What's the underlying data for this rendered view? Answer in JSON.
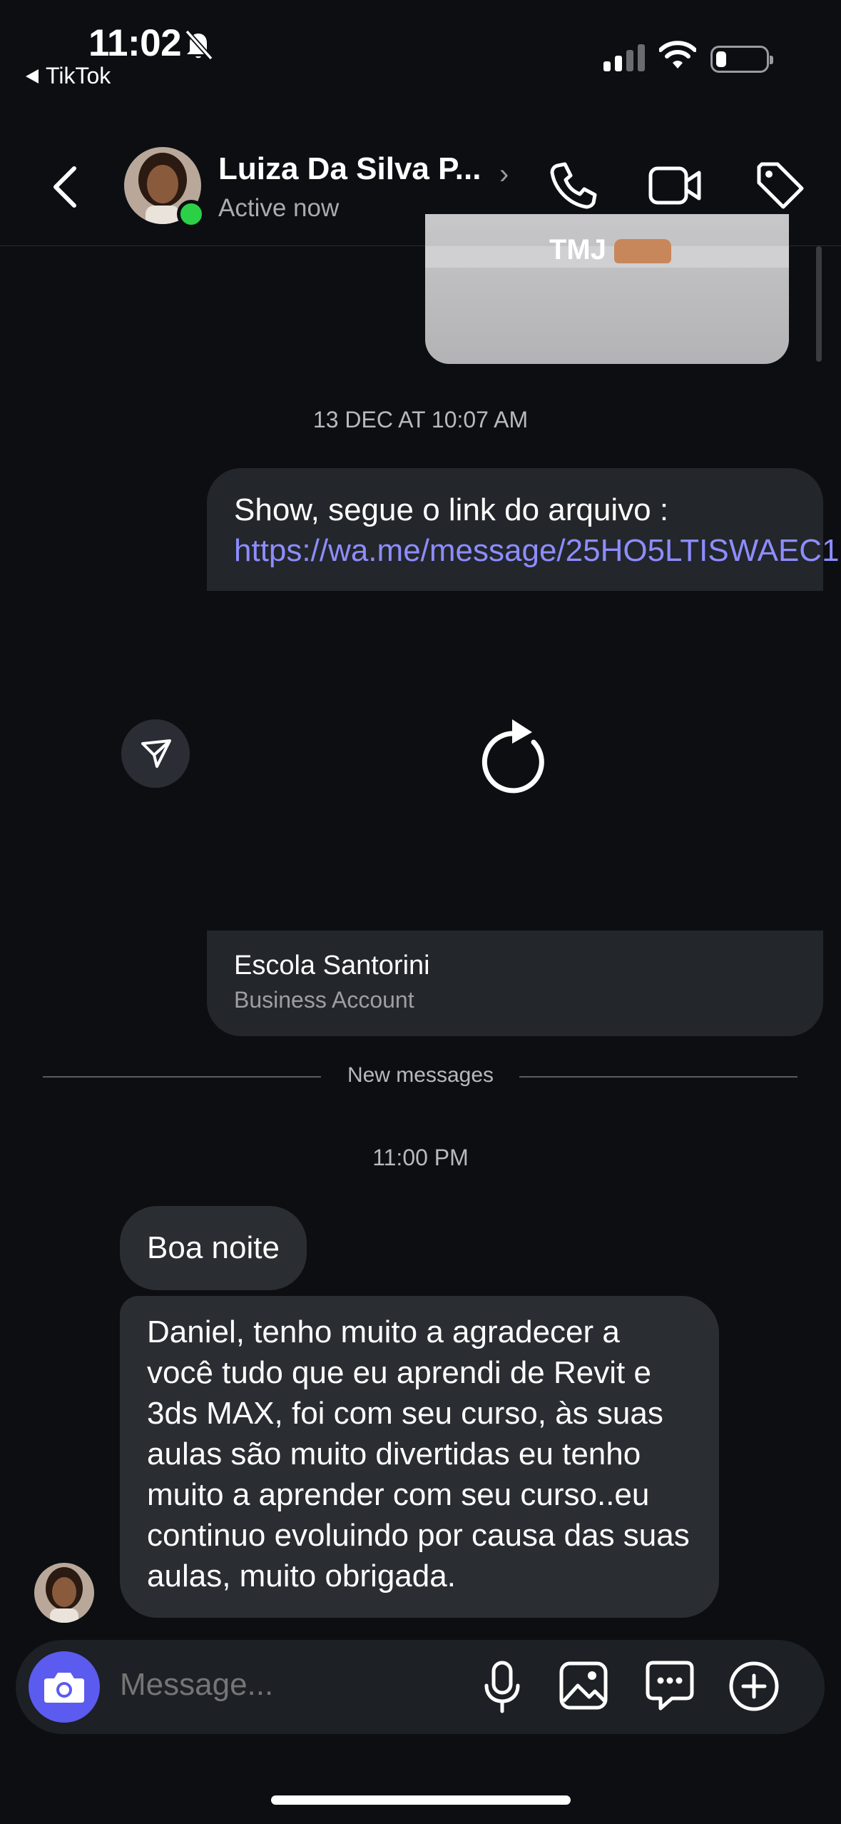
{
  "status_bar": {
    "time": "11:02",
    "back_app": "TikTok"
  },
  "header": {
    "name": "Luiza Da Silva P...",
    "status": "Active now",
    "online_color": "#2bd046"
  },
  "messages": {
    "image_caption": "TMJ",
    "timestamp_1": "13 DEC AT 10:07 AM",
    "sent_text": "Show, segue o link do arquivo : ",
    "sent_link": "https://wa.me/message/25HO5LTISWAEC1",
    "share_title": "Escola Santorini",
    "share_subtitle": "Business Account",
    "new_messages_label": "New messages",
    "timestamp_2": "11:00 PM",
    "received_1": "Boa noite",
    "received_2": "Daniel, tenho muito a agradecer a você tudo que eu aprendi de Revit e 3ds MAX, foi com seu curso, às suas aulas são muito divertidas eu tenho muito a aprender com seu curso..eu continuo evoluindo por causa das suas aulas, muito obrigada."
  },
  "composer": {
    "placeholder": "Message...",
    "accent": "#5b5bf0"
  },
  "icons": [
    "bell-off-icon",
    "signal-icon",
    "wifi-icon",
    "battery-icon",
    "back-chevron-icon",
    "phone-icon",
    "video-icon",
    "tag-icon",
    "send-icon",
    "refresh-icon",
    "camera-icon",
    "microphone-icon",
    "image-icon",
    "chat-icon",
    "plus-circle-icon"
  ]
}
